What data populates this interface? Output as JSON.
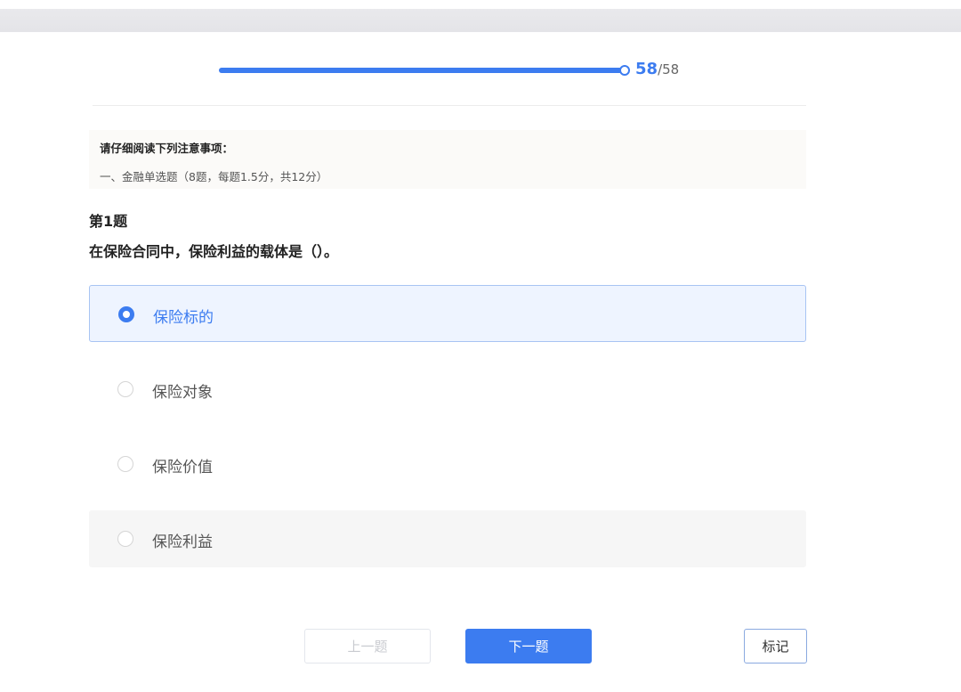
{
  "progress": {
    "current": "58",
    "separator": "/",
    "total": "58",
    "fraction": 1.0
  },
  "notice": {
    "title": "请仔细阅读下列注意事项：",
    "text": "一、金融单选题（8题，每题1.5分，共12分）"
  },
  "question": {
    "number": "第1题",
    "text": "在保险合同中，保险利益的载体是（）。",
    "options": [
      {
        "label": "保险标的",
        "selected": true
      },
      {
        "label": "保险对象",
        "selected": false
      },
      {
        "label": "保险价值",
        "selected": false
      },
      {
        "label": "保险利益",
        "selected": false
      }
    ]
  },
  "buttons": {
    "prev_label": "上一题",
    "next_label": "下一题",
    "mark_label": "标记"
  },
  "colors": {
    "accent": "#3c7cf0",
    "selected_bg": "#eef4ff"
  }
}
